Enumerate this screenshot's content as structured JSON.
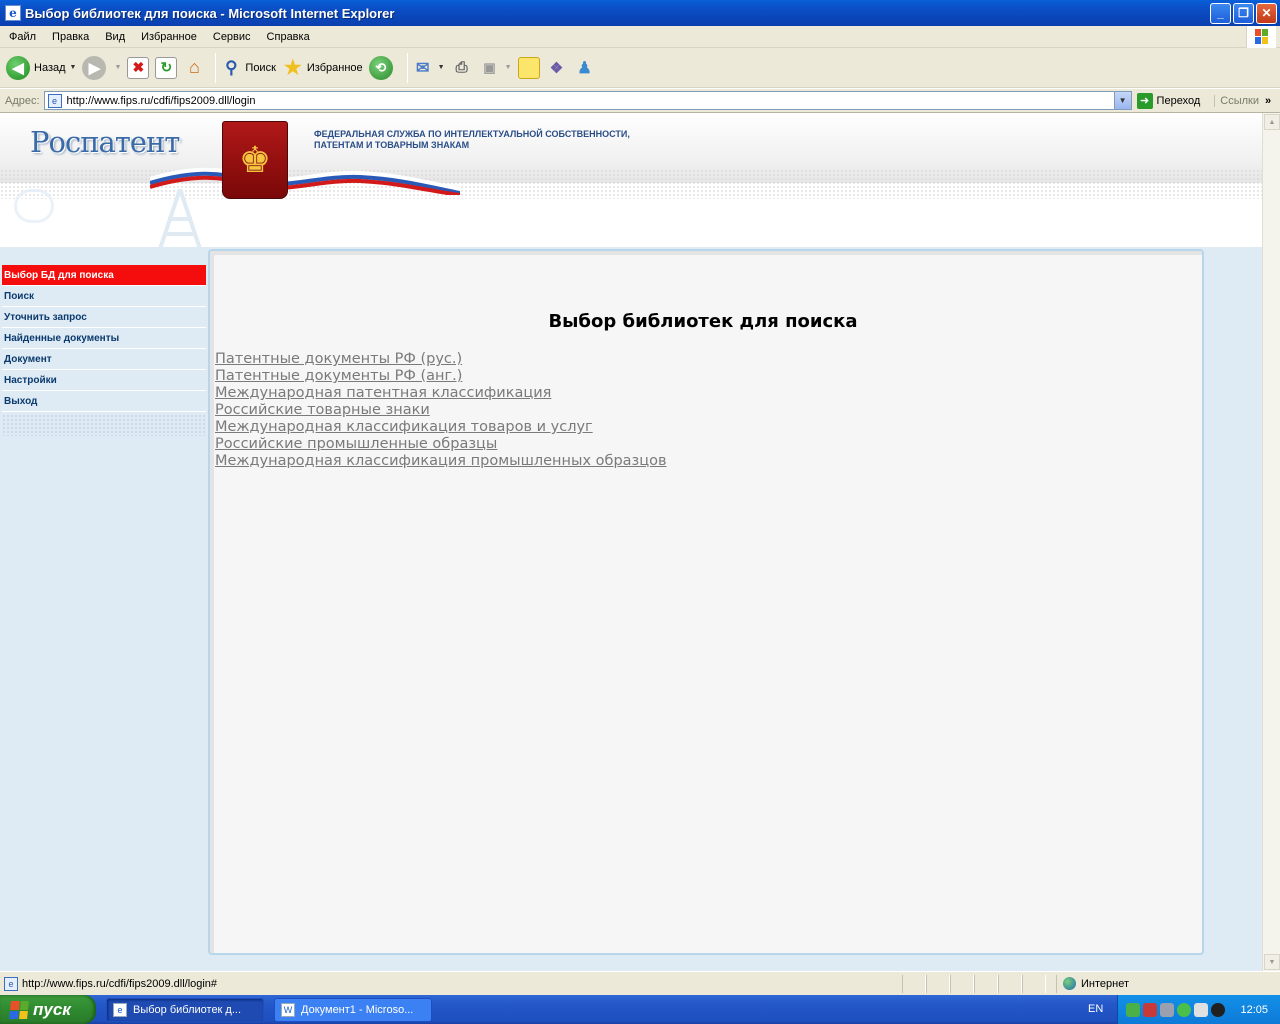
{
  "window": {
    "title": "Выбор библиотек для поиска - Microsoft Internet Explorer",
    "controls": {
      "minimize": "_",
      "maximize": "❐",
      "close": "✕"
    }
  },
  "menu": [
    "Файл",
    "Правка",
    "Вид",
    "Избранное",
    "Сервис",
    "Справка"
  ],
  "toolbar": {
    "back": "Назад",
    "search": "Поиск",
    "favorites": "Избранное"
  },
  "address": {
    "label": "Адрес:",
    "url": "http://www.fips.ru/cdfi/fips2009.dll/login",
    "go": "Переход",
    "links": "Ссылки"
  },
  "site": {
    "logo": "Роспатент",
    "agency_line1": "ФЕДЕРАЛЬНАЯ СЛУЖБА ПО ИНТЕЛЛЕКТУАЛЬНОЙ СОБСТВЕННОСТИ,",
    "agency_line2": "ПАТЕНТАМ И ТОВАРНЫМ ЗНАКАМ",
    "nav": [
      {
        "label": "Выбор БД для поиска",
        "active": true
      },
      {
        "label": "Поиск"
      },
      {
        "label": "Уточнить запрос"
      },
      {
        "label": "Найденные документы"
      },
      {
        "label": "Документ"
      },
      {
        "label": "Настройки"
      },
      {
        "label": "Выход"
      }
    ],
    "heading": "Выбор библиотек для поиска",
    "libraries": [
      "Патентные документы РФ (рус.)",
      "Патентные документы РФ (анг.)",
      "Международная патентная классификация",
      "Российские товарные знаки",
      "Международная классификация товаров и услуг",
      "Российские промышленные образцы",
      "Международная классификация промышленных образцов"
    ]
  },
  "status": {
    "text": "http://www.fips.ru/cdfi/fips2009.dll/login#",
    "zone": "Интернет"
  },
  "taskbar": {
    "start": "пуск",
    "tasks": [
      {
        "label": "Выбор библиотек д...",
        "active": true
      },
      {
        "label": "Документ1 - Microso..."
      }
    ],
    "lang": "EN",
    "clock": "12:05"
  },
  "colors": {
    "nav_active": "#f50c0c",
    "nav_text": "#0b3a6e",
    "link": "#7a7a7a",
    "title_bar": "#0b4cc2"
  }
}
